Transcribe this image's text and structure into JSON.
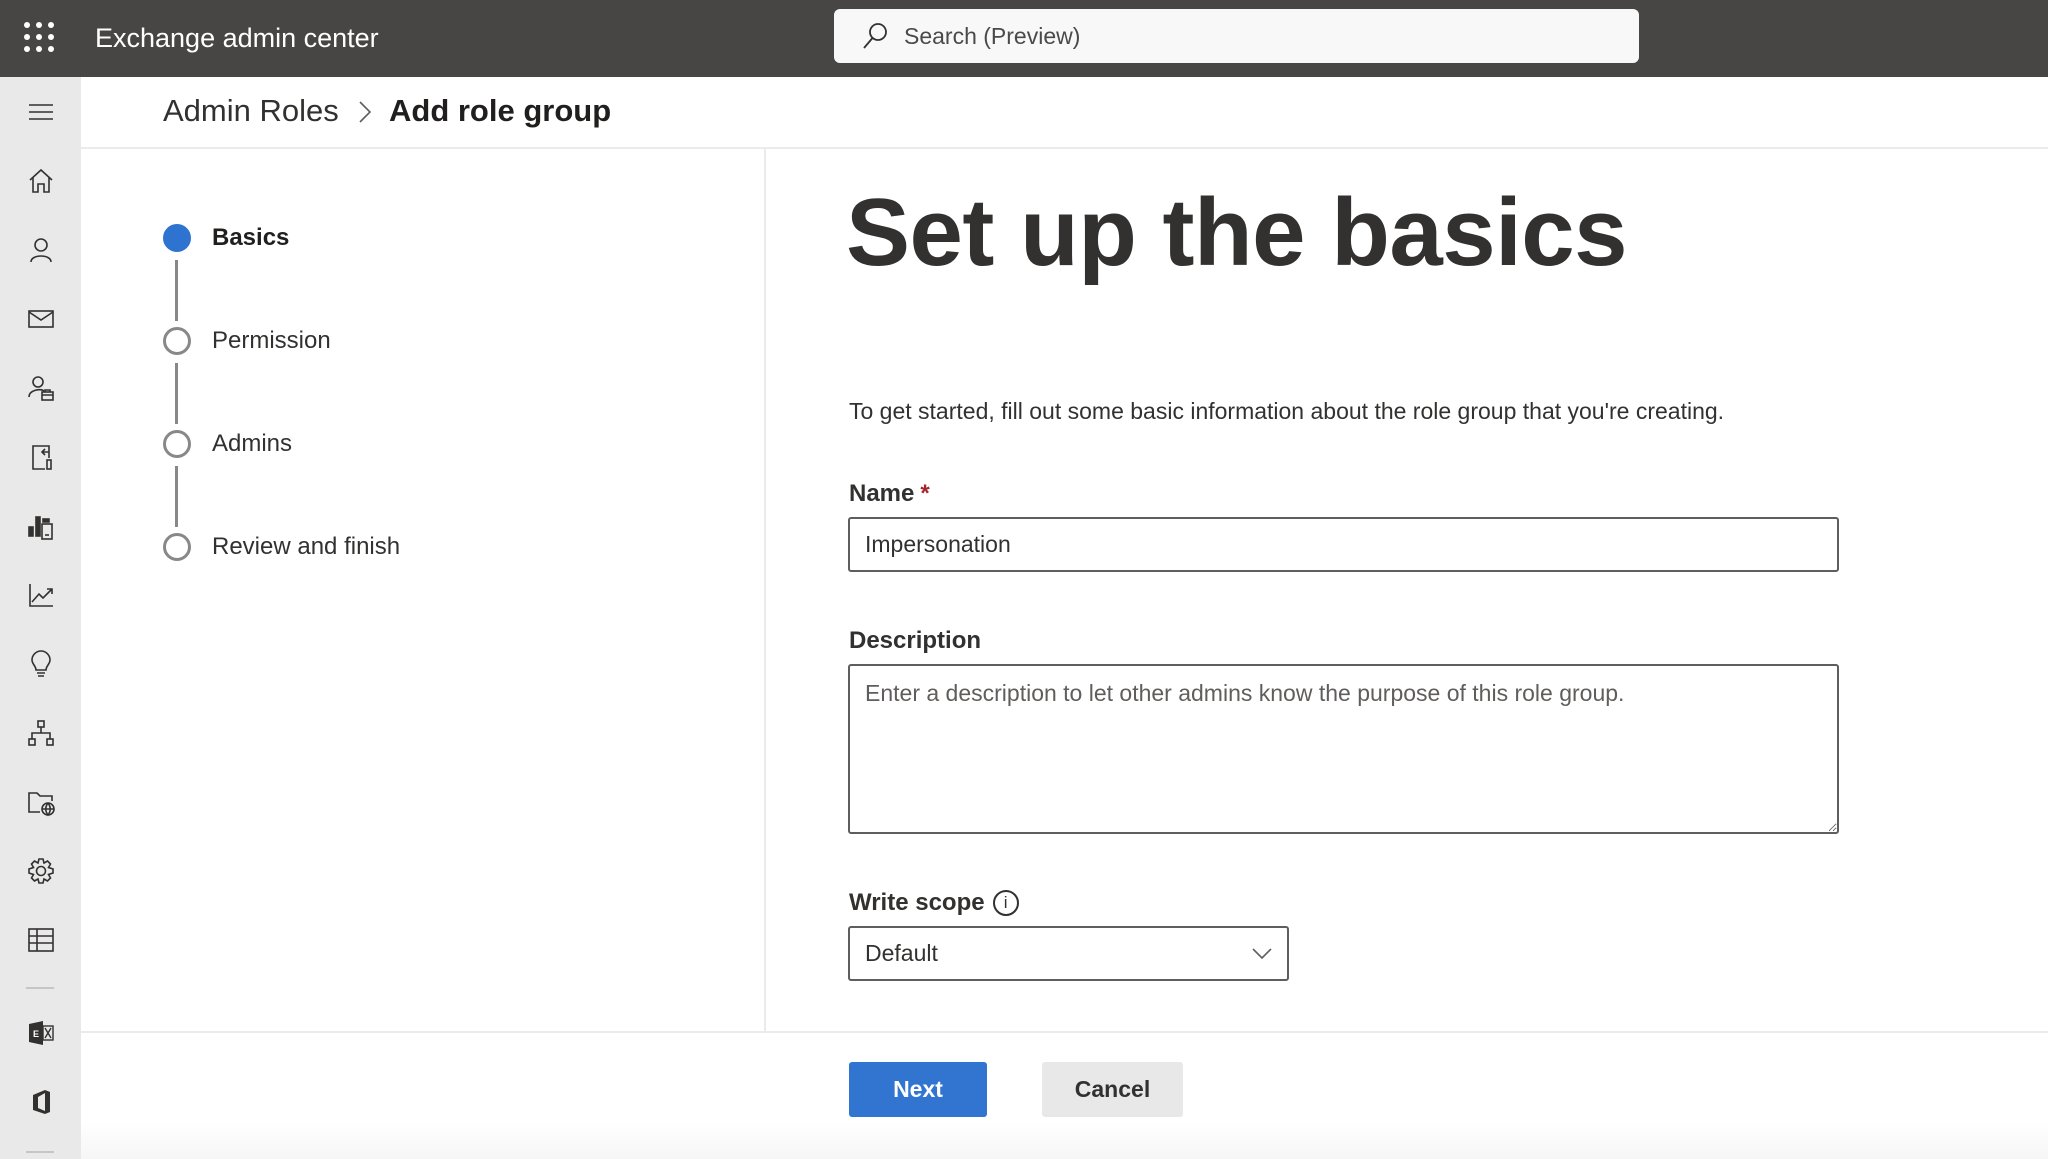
{
  "header": {
    "app_title": "Exchange admin center",
    "search_placeholder": "Search (Preview)"
  },
  "nav_rail": {
    "items": [
      {
        "name": "hamburger-menu",
        "icon": "hamburger-icon"
      },
      {
        "name": "home",
        "icon": "home-icon"
      },
      {
        "name": "recipients",
        "icon": "person-icon"
      },
      {
        "name": "mail-flow",
        "icon": "mail-icon"
      },
      {
        "name": "roles",
        "icon": "person-briefcase-icon"
      },
      {
        "name": "migration",
        "icon": "migration-icon"
      },
      {
        "name": "mobile",
        "icon": "mobile-chart-icon"
      },
      {
        "name": "reports",
        "icon": "line-chart-icon"
      },
      {
        "name": "insights",
        "icon": "lightbulb-icon"
      },
      {
        "name": "organization",
        "icon": "org-chart-icon"
      },
      {
        "name": "public-folders",
        "icon": "folder-globe-icon"
      },
      {
        "name": "settings",
        "icon": "gear-icon"
      },
      {
        "name": "other-features",
        "icon": "table-icon"
      },
      {
        "name": "classic-eac",
        "icon": "exchange-logo-icon"
      },
      {
        "name": "office",
        "icon": "office-logo-icon"
      }
    ]
  },
  "breadcrumb": {
    "parent": "Admin Roles",
    "current": "Add role group"
  },
  "stepper": {
    "steps": [
      {
        "label": "Basics",
        "state": "active"
      },
      {
        "label": "Permission",
        "state": "pending"
      },
      {
        "label": "Admins",
        "state": "pending"
      },
      {
        "label": "Review and finish",
        "state": "pending"
      }
    ]
  },
  "form": {
    "title": "Set up the basics",
    "intro": "To get started, fill out some basic information about the role group that you're creating.",
    "name": {
      "label": "Name",
      "required_marker": "*",
      "value": "Impersonation"
    },
    "description": {
      "label": "Description",
      "placeholder": "Enter a description to let other admins know the purpose of this role group.",
      "value": ""
    },
    "write_scope": {
      "label": "Write scope",
      "info_glyph": "i",
      "selected": "Default"
    }
  },
  "footer": {
    "next_label": "Next",
    "cancel_label": "Cancel"
  },
  "colors": {
    "topbar": "#484644",
    "accent": "#3275d0",
    "required": "#a4262c",
    "rail": "#e9e9e9"
  }
}
